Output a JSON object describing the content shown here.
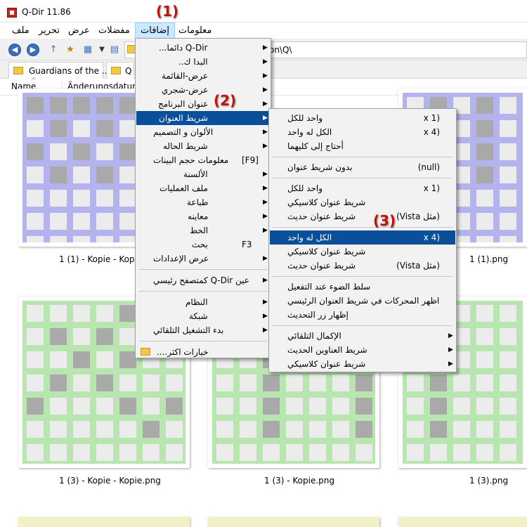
{
  "window": {
    "title": "Q-Dir 11.86"
  },
  "menubar": [
    {
      "label": "ملف"
    },
    {
      "label": "تحرير"
    },
    {
      "label": "عرض"
    },
    {
      "label": "مفضلات"
    },
    {
      "label": "إضافات"
    },
    {
      "label": "معلومات"
    }
  ],
  "address": {
    "path": "\\icon\\Q\\"
  },
  "tabs": [
    {
      "label": "Guardians of the ..."
    },
    {
      "label": "Q"
    }
  ],
  "columns": {
    "name": "Name",
    "modified": "Änderungsdatum"
  },
  "files": [
    {
      "label": "1 (1) - Kopie - Kopie.png",
      "color": "#b3b3ee",
      "dark": [
        0,
        1,
        2,
        3,
        4,
        5,
        6,
        8,
        10,
        12,
        14,
        16,
        18,
        20,
        22,
        24
      ]
    },
    {
      "label": "1 (1).png",
      "color": "#b3b3ee",
      "dark": [
        1,
        3,
        5,
        8,
        10,
        12,
        15,
        17,
        19,
        22,
        24,
        26
      ]
    },
    {
      "label": "1 (3) - Kopie - Kopie.png",
      "color": "#b9e6b0",
      "dark": [
        4,
        8,
        10,
        12,
        16,
        18,
        22,
        24,
        28,
        32,
        34,
        40
      ]
    },
    {
      "label": "1 (3) - Kopie.png",
      "color": "#b9e6b0",
      "dark": [
        2,
        6,
        9,
        13,
        16,
        20,
        23,
        27,
        30,
        34,
        37,
        41
      ]
    },
    {
      "label": "1 (3).png",
      "color": "#b9e6b0",
      "dark": [
        1,
        5,
        8,
        12,
        15,
        19,
        22,
        26,
        29,
        33,
        36,
        40
      ]
    }
  ],
  "extras_menu": [
    {
      "label": "Q-Dir دائما...",
      "arrow": true
    },
    {
      "label": "البدا ك..",
      "arrow": true
    },
    {
      "label": "عرض-القائمة",
      "arrow": true
    },
    {
      "label": "عرض-شجري",
      "arrow": true
    },
    {
      "label": "عنوان البرنامج",
      "arrow": true
    },
    {
      "label": "شريط العنوان",
      "arrow": true,
      "selected": true
    },
    {
      "label": "الألوان و التصميم",
      "arrow": true
    },
    {
      "label": "شريط الحاله",
      "arrow": true
    },
    {
      "label": "معلومات حجم البينات",
      "shortcut": "[F9]"
    },
    {
      "label": "الألسنة",
      "arrow": true
    },
    {
      "label": "ملف العمليات",
      "arrow": true
    },
    {
      "label": "طباعة",
      "arrow": true
    },
    {
      "label": "معاينه",
      "arrow": true
    },
    {
      "label": "الخط",
      "arrow": true
    },
    {
      "label": "بحث",
      "shortcut": "F3"
    },
    {
      "label": "عرض الإعدادات",
      "arrow": true
    },
    {
      "separator": true
    },
    {
      "label": "عين Q-Dir كمتصفح رئيسي",
      "arrow": true
    },
    {
      "separator": true
    },
    {
      "label": "النظام",
      "arrow": true
    },
    {
      "label": "شبكة",
      "arrow": true
    },
    {
      "label": "بدء التشغيل التلقائي",
      "arrow": true
    },
    {
      "separator": true
    },
    {
      "label": "خيارات اكثر....",
      "folder": true
    }
  ],
  "titlebar_menu": [
    {
      "label": "واحد للكل",
      "right": "(x 1"
    },
    {
      "label": "الكل له واحد",
      "right": "(x 4"
    },
    {
      "label": "أحتاج إلى كليهما"
    },
    {
      "separator": true
    },
    {
      "label": "بدون شريط عنوان",
      "right": "(null)"
    },
    {
      "separator": true
    },
    {
      "label": "واحد للكل",
      "right": "(x 1"
    },
    {
      "label": "شريط عنوان كلاسيكي"
    },
    {
      "label": "شريط عنوان حديث",
      "right": "(مثل Vista)"
    },
    {
      "separator": true
    },
    {
      "label": "الكل له واحد",
      "right": "(x 4",
      "selected": true
    },
    {
      "label": "شريط عنوان كلاسيكي"
    },
    {
      "label": "شريط عنوان حديث",
      "right": "(مثل Vista)"
    },
    {
      "separator": true
    },
    {
      "label": "سلط الضوء عند التفعيل"
    },
    {
      "label": "اظهر المحركات في شريط العنوان الرئيسي"
    },
    {
      "label": "إظهار زر التحديث"
    },
    {
      "separator": true
    },
    {
      "label": "الإكمال التلقائي",
      "arrow": true
    },
    {
      "label": "شريط العناوين الحديث",
      "arrow": true
    },
    {
      "label": "شريط عنوان كلاسيكي",
      "arrow": true
    }
  ],
  "annotations": [
    "(1)",
    "(2)",
    "(3)"
  ]
}
